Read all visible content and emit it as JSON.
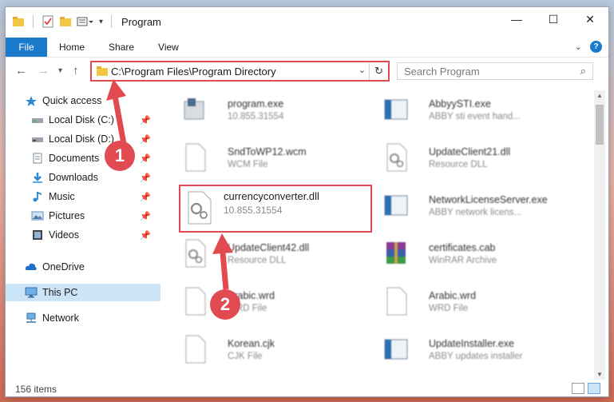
{
  "window": {
    "title": "Program",
    "controls": {
      "minimize": "—",
      "maximize": "☐",
      "close": "✕"
    }
  },
  "ribbon": {
    "file_tab": "File",
    "tabs": [
      "Home",
      "Share",
      "View"
    ]
  },
  "navigation": {
    "back": "←",
    "forward": "→",
    "recent": "▾",
    "up": "↑",
    "address": "C:\\Program Files\\Program Directory",
    "search_placeholder": "Search Program"
  },
  "sidebar": {
    "items": [
      {
        "label": "Quick access",
        "icon": "star-icon",
        "pinned": false
      },
      {
        "label": "Local Disk (C:)",
        "icon": "drive-icon",
        "pinned": true
      },
      {
        "label": "Local Disk (D:)",
        "icon": "drive-icon",
        "pinned": true
      },
      {
        "label": "Documents",
        "icon": "documents-icon",
        "pinned": true
      },
      {
        "label": "Downloads",
        "icon": "downloads-icon",
        "pinned": true
      },
      {
        "label": "Music",
        "icon": "music-icon",
        "pinned": true
      },
      {
        "label": "Pictures",
        "icon": "pictures-icon",
        "pinned": true
      },
      {
        "label": "Videos",
        "icon": "videos-icon",
        "pinned": true
      },
      {
        "label": "OneDrive",
        "icon": "cloud-icon",
        "pinned": false
      },
      {
        "label": "This PC",
        "icon": "computer-icon",
        "pinned": false,
        "selected": true
      },
      {
        "label": "Network",
        "icon": "network-icon",
        "pinned": false
      }
    ]
  },
  "files": [
    {
      "name": "program.exe",
      "desc": "10.855.31554",
      "icon": "exe-icon"
    },
    {
      "name": "AbbyySTI.exe",
      "desc": "ABBY sti event hand...",
      "icon": "app-window-icon"
    },
    {
      "name": "SndToWP12.wcm",
      "desc": "WCM File",
      "icon": "blank-file-icon"
    },
    {
      "name": "UpdateClient21.dll",
      "desc": "Resource DLL",
      "icon": "dll-icon"
    },
    {
      "name": "currencyconverter.dll",
      "desc": "10.855.31554",
      "icon": "dll-icon",
      "highlighted": true
    },
    {
      "name": "NetworkLicenseServer.exe",
      "desc": "ABBY network licens...",
      "icon": "app-window-icon"
    },
    {
      "name": "UpdateClient42.dll",
      "desc": "Resource DLL",
      "icon": "dll-icon"
    },
    {
      "name": "certificates.cab",
      "desc": "WinRAR Archive",
      "icon": "archive-icon"
    },
    {
      "name": "Arabic.wrd",
      "desc": "WRD File",
      "icon": "blank-file-icon"
    },
    {
      "name": "Arabic.wrd",
      "desc": "WRD File",
      "icon": "blank-file-icon"
    },
    {
      "name": "Korean.cjk",
      "desc": "CJK File",
      "icon": "blank-file-icon"
    },
    {
      "name": "UpdateInstaller.exe",
      "desc": "ABBY updates installer",
      "icon": "app-window-icon"
    }
  ],
  "status": {
    "item_count": "156 items"
  },
  "annotations": {
    "step1": "1",
    "step2": "2",
    "color": "#e04a50"
  },
  "colors": {
    "accent": "#1979ca",
    "selection": "#cce4f7",
    "highlight": "#e04a50"
  }
}
